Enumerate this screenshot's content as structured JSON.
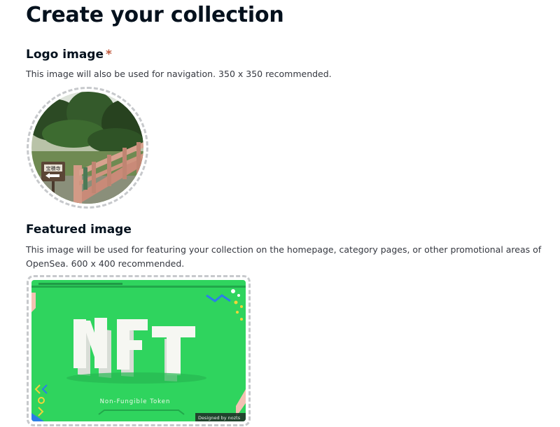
{
  "page": {
    "title": "Create your collection"
  },
  "logo_section": {
    "title": "Logo image",
    "required_marker": "*",
    "description": "This image will also be used for navigation. 350 x 350 recommended.",
    "sign_text": "宝積寺"
  },
  "featured_section": {
    "title": "Featured image",
    "description": "This image will be used for featuring your collection on the homepage, category pages, or other promotional areas of OpenSea. 600 x 400 recommended.",
    "image_text": {
      "headline": "NFT",
      "subtitle": "Non-Fungible Token",
      "credit": "Designed by nozts"
    }
  },
  "colors": {
    "required": "#c05a3e",
    "nft_green": "#2fd45e",
    "dashed_border": "#c7c9cc"
  }
}
